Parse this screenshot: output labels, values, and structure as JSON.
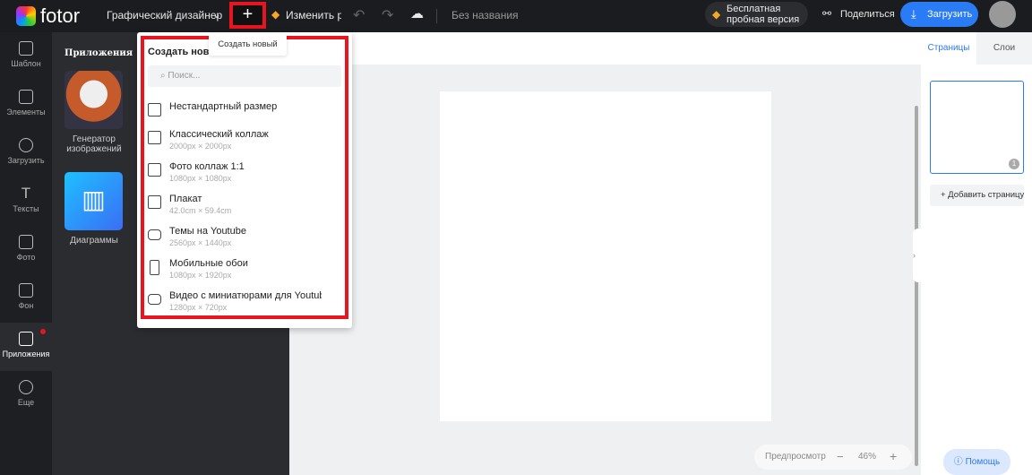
{
  "topbar": {
    "logo": "fotor",
    "mode": "Графический дизайнер",
    "new_tooltip": "Создать новый",
    "resize": "Изменить ра",
    "doc_title": "Без названия",
    "trial": [
      "Бесплатная",
      "пробная версия"
    ],
    "share": "Поделиться",
    "download": "Загрузить"
  },
  "rail": [
    {
      "label": "Шаблон",
      "icon": "template-icon"
    },
    {
      "label": "Элементы",
      "icon": "elements-icon"
    },
    {
      "label": "Загрузить",
      "icon": "upload-icon"
    },
    {
      "label": "Тексты",
      "icon": "text-icon"
    },
    {
      "label": "Фото",
      "icon": "photo-icon"
    },
    {
      "label": "Фон",
      "icon": "background-icon"
    },
    {
      "label": "Приложения",
      "icon": "apps-icon"
    },
    {
      "label": "Еще",
      "icon": "more-icon"
    }
  ],
  "panel": {
    "title": "Приложения",
    "apps": [
      {
        "label1": "Генератор",
        "label2": "изображений"
      },
      {
        "label1": "Диаграммы"
      }
    ]
  },
  "dropdown": {
    "title": "Создать новый",
    "search_placeholder": "Поиск...",
    "items": [
      {
        "name": "Нестандартный размер",
        "size": ""
      },
      {
        "name": "Классический коллаж",
        "size": "2000px × 2000px"
      },
      {
        "name": "Фото коллаж 1:1",
        "size": "1080px × 1080px"
      },
      {
        "name": "Плакат",
        "size": "42.0cm × 59.4cm"
      },
      {
        "name": "Темы на Youtube",
        "size": "2560px × 1440px"
      },
      {
        "name": "Мобильные обои",
        "size": "1080px × 1920px"
      },
      {
        "name": "Видео с миниатюрами для Youtube",
        "size": "1280px × 720px"
      }
    ]
  },
  "right": {
    "tab_pages": "Страницы",
    "tab_layers": "Слои",
    "page_num": "1",
    "add_page": "+ Добавить страницу",
    "help": "Помощь"
  },
  "zoom": {
    "preview": "Предпросмотр",
    "value": "46%",
    "minus": "−",
    "plus": "+"
  },
  "colors": {
    "accent": "#2a7bf6",
    "highlight": "#e8141f"
  }
}
